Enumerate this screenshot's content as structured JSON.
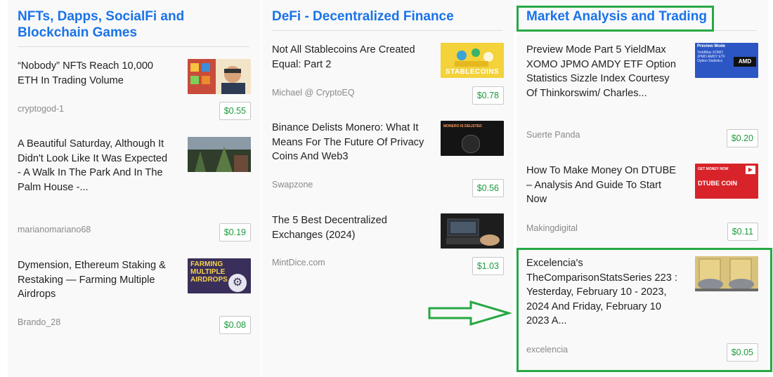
{
  "columns": [
    {
      "title": "NFTs, Dapps, SocialFi and Blockchain Games",
      "posts": [
        {
          "title": "“Nobody” NFTs Reach 10,000 ETH In Trading Volume",
          "author": "cryptogod-1",
          "price": "$0.55"
        },
        {
          "title": "A Beautiful Saturday, Although It Didn't Look Like It Was Expected - A Walk In The Park And In The Palm House -...",
          "author": "marianomariano68",
          "price": "$0.19"
        },
        {
          "title": "Dymension, Ethereum Staking & Restaking — Farming Multiple Airdrops",
          "author": "Brando_28",
          "price": "$0.08",
          "thumb_text": "FARMING MULTIPLE AIRDROPS"
        }
      ]
    },
    {
      "title": "DeFi - Decentralized Finance",
      "posts": [
        {
          "title": "Not All Stablecoins Are Created Equal: Part 2",
          "author": "Michael @ CryptoEQ",
          "price": "$0.78",
          "thumb_text": "STABLECOINS"
        },
        {
          "title": "Binance Delists Monero: What It Means For The Future Of Privacy Coins And Web3",
          "author": "Swapzone",
          "price": "$0.56",
          "thumb_text": "MONERO IS DELISTED"
        },
        {
          "title": "The 5 Best Decentralized Exchanges (2024)",
          "author": "MintDice.com",
          "price": "$1.03"
        }
      ]
    },
    {
      "title": "Market Analysis and Trading",
      "posts": [
        {
          "title": "Preview Mode Part 5 YieldMax XOMO JPMO AMDY ETF Option Statistics Sizzle Index Courtesy Of Thinkorswim/ Charles...",
          "author": "Suerte Panda",
          "price": "$0.20",
          "thumb_text": "Preview Mode",
          "thumb_text2": "YieldMax XOMO JPMO AMDY ETF Option Statistics",
          "thumb_text3": "AMD"
        },
        {
          "title": "How To Make Money On DTUBE – Analysis And Guide To Start Now",
          "author": "Makingdigital",
          "price": "$0.11",
          "thumb_text": "GET MONEY NOW",
          "thumb_text2": "DTUBE COIN"
        },
        {
          "title": "Excelencia's TheComparisonStatsSeries 223 : Yesterday, February 10 - 2023, 2024 And Friday, February 10 2023 A...",
          "author": "excelencia",
          "price": "$0.05"
        }
      ]
    }
  ],
  "colors": {
    "link_blue": "#1a73e8",
    "price_green": "#1e9a3c",
    "highlight_green": "#27a844"
  }
}
